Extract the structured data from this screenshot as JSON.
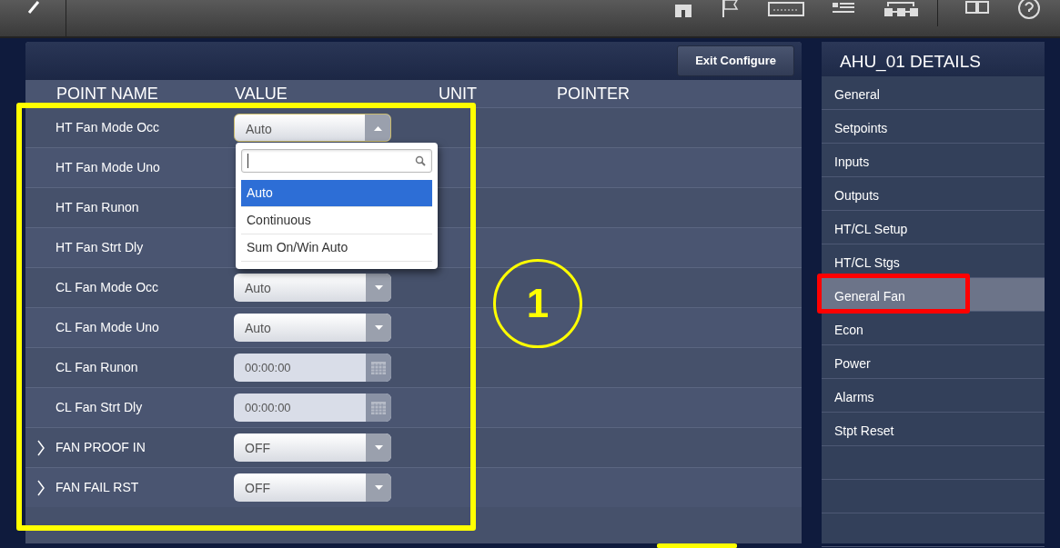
{
  "panel": {
    "exit_button": "Exit Configure",
    "columns": [
      "POINT NAME",
      "VALUE",
      "UNIT",
      "POINTER"
    ],
    "rows": [
      {
        "name": "HT Fan Mode Occ",
        "kind": "select",
        "value": "Auto",
        "expanded": true,
        "expandable": false
      },
      {
        "name": "HT Fan Mode Uno",
        "kind": "hidden",
        "expandable": false
      },
      {
        "name": "HT Fan Runon",
        "kind": "hidden",
        "expandable": false
      },
      {
        "name": "HT Fan Strt Dly",
        "kind": "hidden",
        "expandable": false
      },
      {
        "name": "CL Fan Mode Occ",
        "kind": "select",
        "value": "Auto",
        "expanded": false,
        "expandable": false
      },
      {
        "name": "CL Fan Mode Uno",
        "kind": "select",
        "value": "Auto",
        "expanded": false,
        "expandable": false
      },
      {
        "name": "CL Fan Runon",
        "kind": "time",
        "value": "00:00:00",
        "expandable": false
      },
      {
        "name": "CL Fan Strt Dly",
        "kind": "time",
        "value": "00:00:00",
        "expandable": false
      },
      {
        "name": "FAN PROOF IN",
        "kind": "select",
        "value": "OFF",
        "expanded": false,
        "expandable": true
      },
      {
        "name": "FAN FAIL RST",
        "kind": "select",
        "value": "OFF",
        "expanded": false,
        "expandable": true
      }
    ],
    "dropdown": {
      "options": [
        {
          "label": "Auto",
          "selected": true
        },
        {
          "label": "Continuous",
          "selected": false
        },
        {
          "label": "Sum On/Win Auto",
          "selected": false
        }
      ]
    }
  },
  "details": {
    "title": "AHU_01 DETAILS",
    "items": [
      {
        "label": "General",
        "selected": false
      },
      {
        "label": "Setpoints",
        "selected": false
      },
      {
        "label": "Inputs",
        "selected": false
      },
      {
        "label": "Outputs",
        "selected": false
      },
      {
        "label": "HT/CL Setup",
        "selected": false
      },
      {
        "label": "HT/CL Stgs",
        "selected": false
      },
      {
        "label": "General Fan",
        "selected": true
      },
      {
        "label": "Econ",
        "selected": false
      },
      {
        "label": "Power",
        "selected": false
      },
      {
        "label": "Alarms",
        "selected": false
      },
      {
        "label": "Stpt Reset",
        "selected": false
      }
    ]
  },
  "annotations": {
    "step_label": "1"
  }
}
